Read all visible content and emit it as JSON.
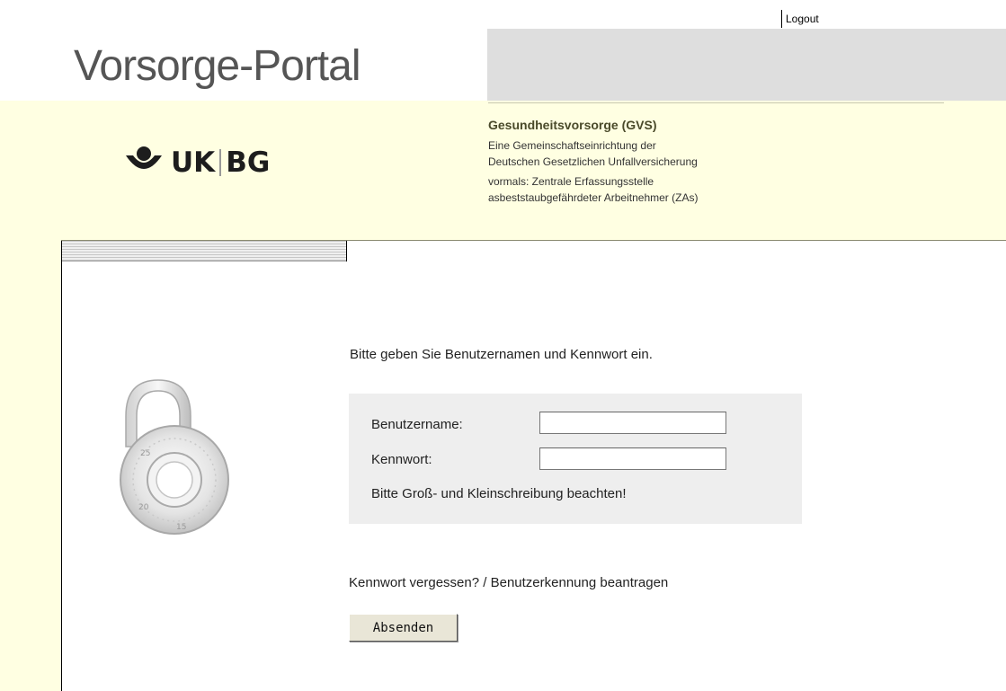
{
  "header": {
    "logout_label": "Logout",
    "portal_title": "Vorsorge-Portal"
  },
  "logo": {
    "left": "UK",
    "right": "BG"
  },
  "info": {
    "title": "Gesundheitsvorsorge (GVS)",
    "line1": "Eine Gemeinschaftseinrichtung der",
    "line2": "Deutschen Gesetzlichen Unfallversicherung",
    "line3": "vormals: Zentrale Erfassungsstelle",
    "line4": "asbeststaubgefährdeter Arbeitnehmer (ZAs)"
  },
  "login": {
    "prompt": "Bitte geben Sie Benutzernamen und Kennwort ein.",
    "username_label": "Benutzername:",
    "username_value": "",
    "password_label": "Kennwort:",
    "password_value": "",
    "case_hint": "Bitte Groß- und Kleinschreibung beachten!",
    "forgot_label": "Kennwort vergessen?",
    "separator": " / ",
    "request_label": "Benutzerkennung beantragen",
    "submit_label": "Absenden"
  },
  "colors": {
    "band_background": "#ffffe2",
    "banner_grey": "#dedede",
    "panel_grey": "#eeeeee"
  },
  "icons": {
    "lock": "padlock-combination-icon",
    "brand": "ukbg-logo-icon"
  }
}
